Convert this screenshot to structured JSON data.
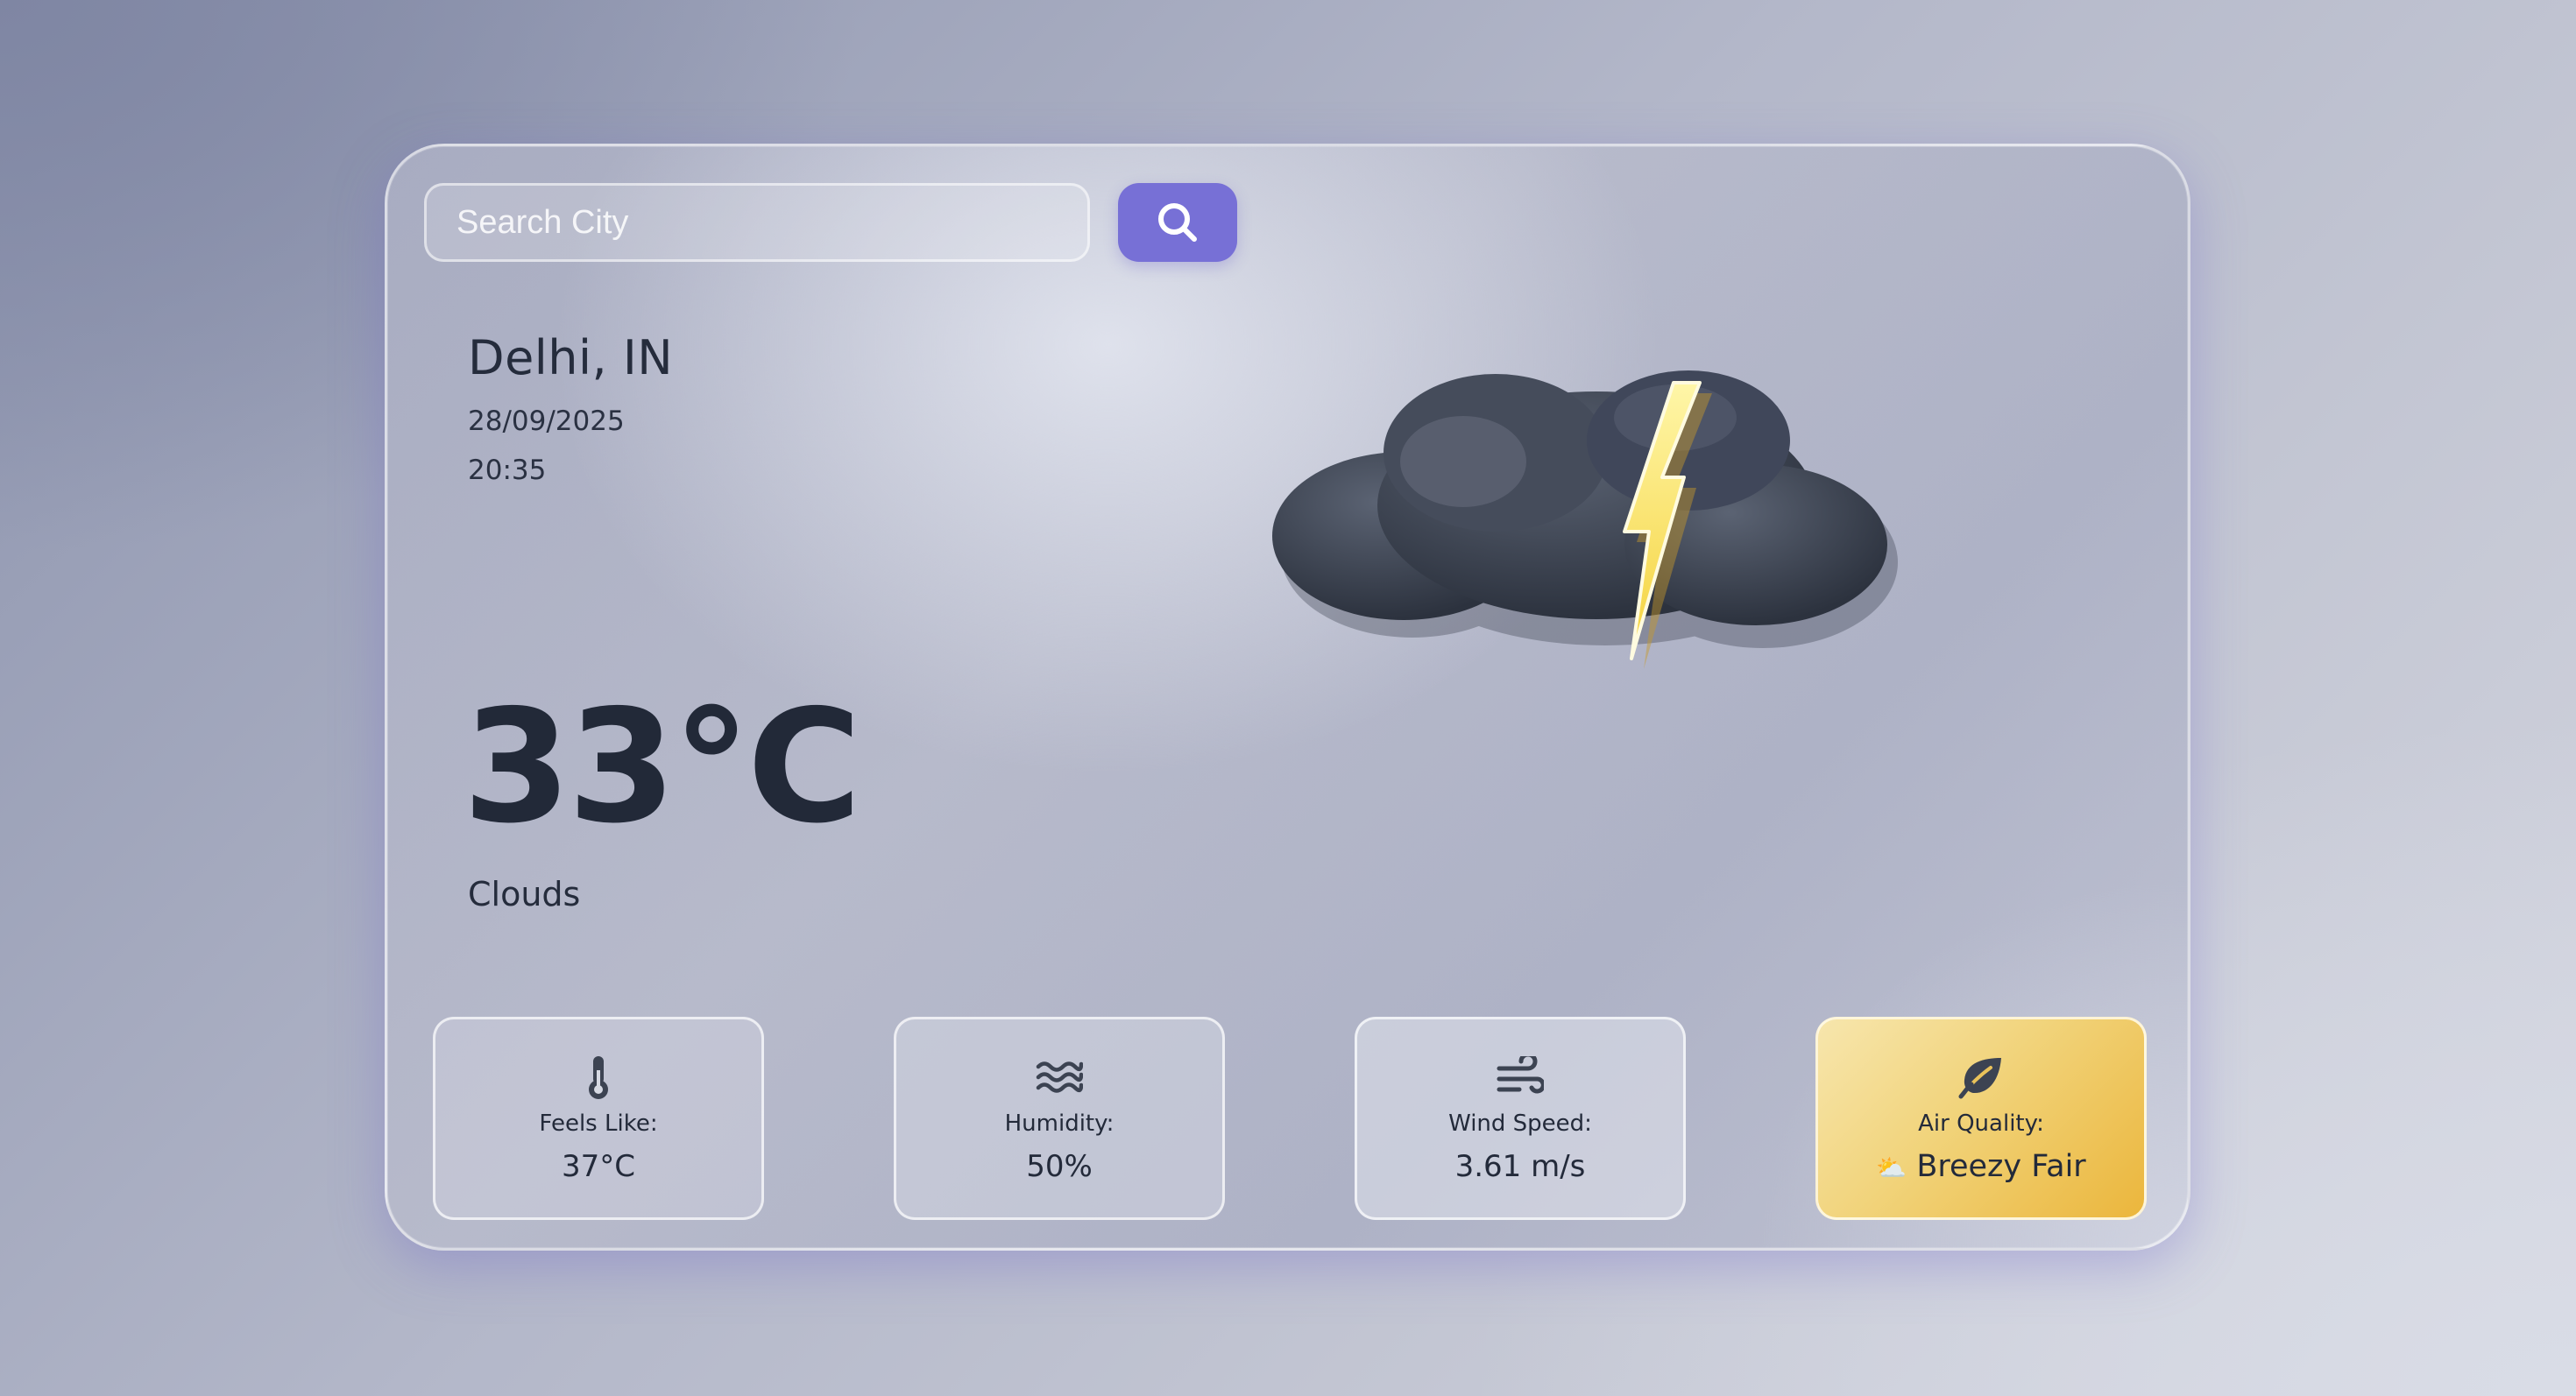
{
  "search": {
    "placeholder": "Search City",
    "button_icon": "search-icon"
  },
  "location": {
    "city": "Delhi, IN",
    "date": "28/09/2025",
    "time": "20:35"
  },
  "weather": {
    "temperature": "33°C",
    "description": "Clouds",
    "illustration": "thunderstorm-cloud-icon"
  },
  "stats": [
    {
      "icon": "thermometer-icon",
      "label": "Feels Like:",
      "value": "37°C"
    },
    {
      "icon": "humidity-waves-icon",
      "label": "Humidity:",
      "value": "50%"
    },
    {
      "icon": "wind-icon",
      "label": "Wind Speed:",
      "value": "3.61 m/s"
    },
    {
      "icon": "leaf-icon",
      "label": "Air Quality:",
      "value": "Breezy Fair",
      "value_emoji": "⛅"
    }
  ],
  "colors": {
    "accent": "#7770d6",
    "air_quality_gold": "#ebb63c",
    "text": "#232a3a"
  }
}
